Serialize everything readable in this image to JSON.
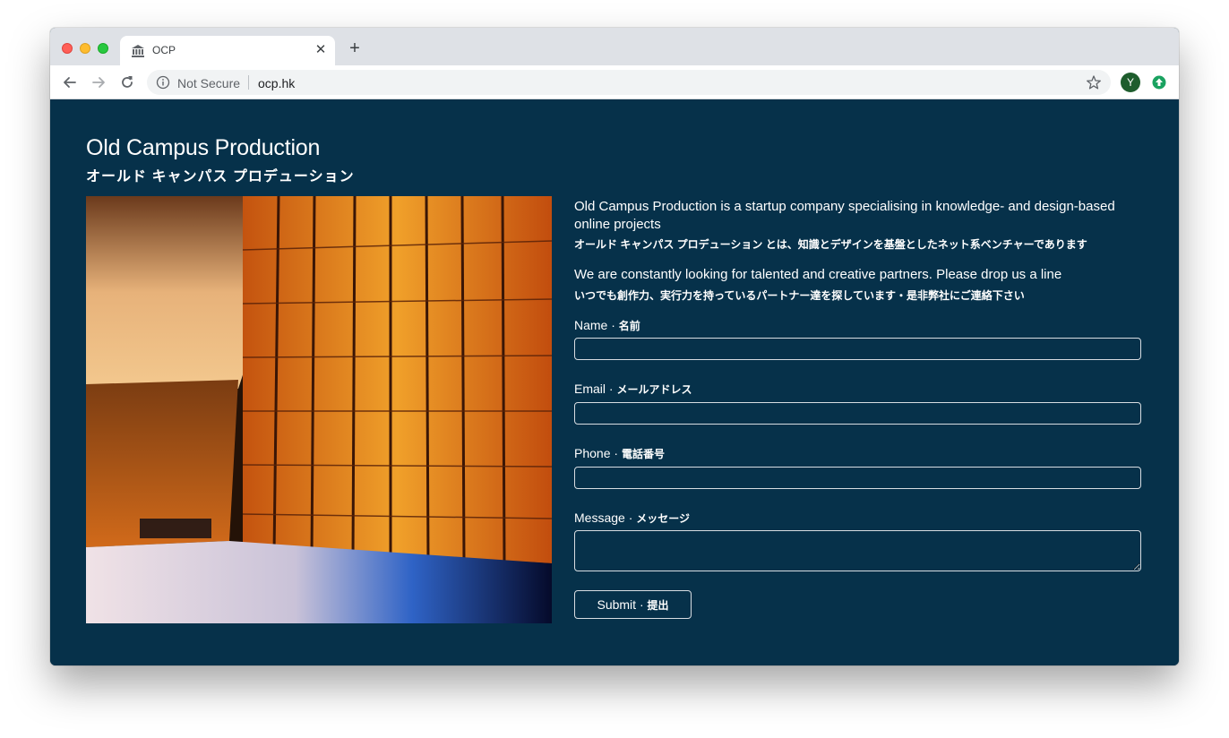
{
  "browser": {
    "tab_title": "OCP",
    "tab_icon": "bank-icon",
    "security_label": "Not Secure",
    "url": "ocp.hk",
    "avatar_letter": "Y"
  },
  "page": {
    "title": "Old Campus Production",
    "subtitle": "オールド キャンパス プロデューション",
    "hero_image": "library-bookshelves-image",
    "intro_en": "Old Campus Production is a startup company specialising in knowledge- and design-based online projects",
    "intro_ja": "オールド キャンパス プロデューション とは、知識とデザインを基盤としたネット系ベンチャーであります",
    "partner_en": "We are constantly looking for talented and creative partners. Please drop us a line",
    "partner_ja": "いつでも創作力、実行力を持っているパートナー達を探しています・是非弊社にご連絡下さい"
  },
  "form": {
    "name_label": "Name · ",
    "name_label_ja": "名前",
    "name_value": "",
    "email_label": "Email · ",
    "email_label_ja": "メールアドレス",
    "email_value": "",
    "phone_label": "Phone · ",
    "phone_label_ja": "電話番号",
    "phone_value": "",
    "message_label": "Message · ",
    "message_label_ja": "メッセージ",
    "message_value": "",
    "submit_label": "Submit · ",
    "submit_label_ja": "提出"
  },
  "colors": {
    "page_background": "#06314a",
    "text": "#ffffff",
    "input_border": "#d8dde2",
    "avatar": "#1e5d2d"
  }
}
